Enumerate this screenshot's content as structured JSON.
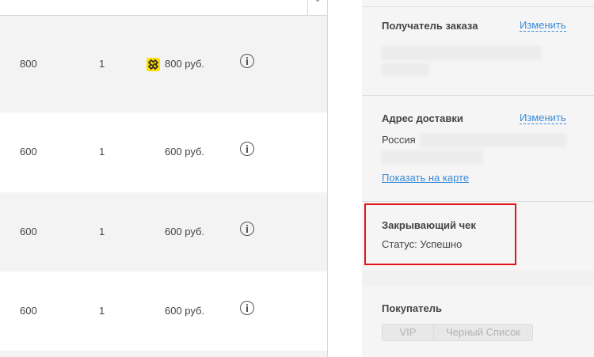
{
  "order_items": [
    {
      "price": "800",
      "qty": "1",
      "total": "800 руб.",
      "has_badge": true
    },
    {
      "price": "600",
      "qty": "1",
      "total": "600 руб.",
      "has_badge": false
    },
    {
      "price": "600",
      "qty": "1",
      "total": "600 руб.",
      "has_badge": false
    },
    {
      "price": "600",
      "qty": "1",
      "total": "600 руб.",
      "has_badge": false
    }
  ],
  "recipient": {
    "label": "Получатель заказа",
    "change_label": "Изменить"
  },
  "address": {
    "label": "Адрес доставки",
    "change_label": "Изменить",
    "country": "Россия",
    "map_link": "Показать на карте"
  },
  "receipt": {
    "label": "Закрывающий чек",
    "status": "Статус: Успешно"
  },
  "buyer": {
    "label": "Покупатель",
    "tags": [
      "VIP",
      "Черный Список"
    ]
  },
  "colors": {
    "link": "#3a8bd8",
    "highlight": "#e1141b",
    "badge": "#ffdd00"
  }
}
